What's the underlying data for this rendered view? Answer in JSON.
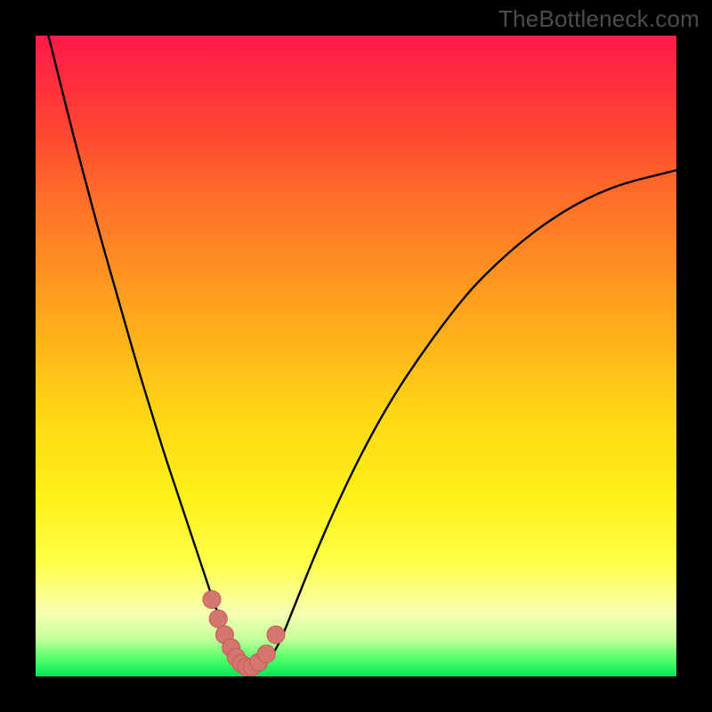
{
  "watermark": "TheBottleneck.com",
  "colors": {
    "bg": "#000000",
    "curve": "#000000",
    "marker_fill": "#d4766f",
    "marker_stroke": "#c55a52"
  },
  "chart_data": {
    "type": "line",
    "title": "",
    "xlabel": "",
    "ylabel": "",
    "xlim": [
      0,
      100
    ],
    "ylim": [
      0,
      100
    ],
    "x": [
      0,
      2,
      4,
      6,
      8,
      10,
      12,
      14,
      16,
      18,
      20,
      22,
      24,
      26,
      27,
      28,
      29,
      30,
      31,
      32,
      33,
      34,
      35,
      36,
      38,
      40,
      44,
      48,
      52,
      56,
      60,
      64,
      68,
      72,
      76,
      80,
      84,
      88,
      92,
      96,
      100
    ],
    "y": [
      108,
      100,
      92,
      84,
      76.5,
      69,
      62,
      55,
      48,
      41.5,
      35,
      29,
      23,
      17,
      14,
      11,
      8.5,
      6,
      4,
      2.5,
      1.5,
      1,
      1,
      2,
      5,
      10,
      20,
      29,
      37,
      44,
      50,
      55.5,
      60.5,
      64.5,
      68,
      71,
      73.5,
      75.5,
      77,
      78,
      79
    ],
    "markers": {
      "x": [
        27.5,
        28.5,
        29.5,
        30.5,
        31.3,
        32.1,
        32.9,
        33.8,
        34.8,
        36.0,
        37.5
      ],
      "y": [
        12.0,
        9.0,
        6.5,
        4.5,
        3.0,
        2.0,
        1.5,
        1.5,
        2.2,
        3.5,
        6.5
      ]
    }
  }
}
